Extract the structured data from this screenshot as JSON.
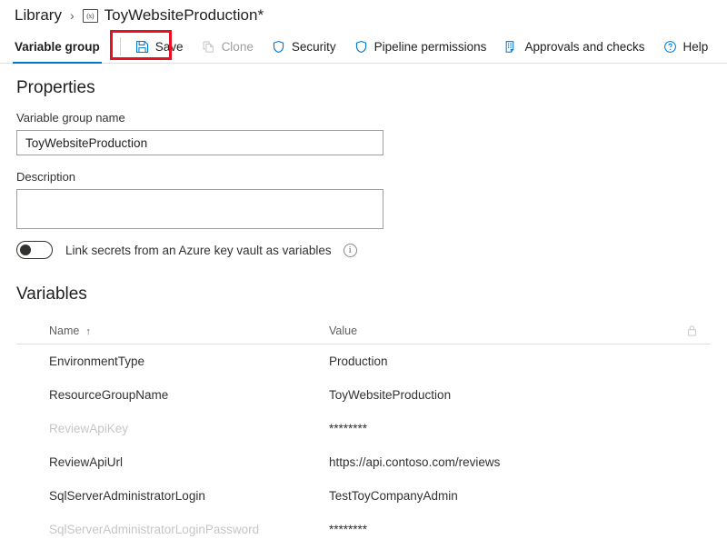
{
  "breadcrumb": {
    "root_label": "Library",
    "separator": "›",
    "icon_text": "(x)",
    "icon_name": "variable-group-icon",
    "current_label": "ToyWebsiteProduction*"
  },
  "toolbar": {
    "tab_label": "Variable group",
    "save_label": "Save",
    "clone_label": "Clone",
    "security_label": "Security",
    "pipeline_permissions_label": "Pipeline permissions",
    "approvals_label": "Approvals and checks",
    "help_label": "Help",
    "accent_color": "#0078d4",
    "highlight_color": "#e81123",
    "disabled_color": "#a19f9d"
  },
  "properties": {
    "section_title": "Properties",
    "name_label": "Variable group name",
    "name_value": "ToyWebsiteProduction",
    "name_placeholder": "",
    "description_label": "Description",
    "description_value": "",
    "description_placeholder": "",
    "keyvault_toggle_label": "Link secrets from an Azure key vault as variables",
    "keyvault_toggle_state": "off",
    "info_glyph": "i"
  },
  "variables": {
    "section_title": "Variables",
    "columns": {
      "name": "Name",
      "sort_indicator": "↑",
      "value": "Value",
      "lock": "lock-icon"
    },
    "rows": [
      {
        "name": "EnvironmentType",
        "value": "Production",
        "secret": false
      },
      {
        "name": "ResourceGroupName",
        "value": "ToyWebsiteProduction",
        "secret": false
      },
      {
        "name": "ReviewApiKey",
        "value": "********",
        "secret": true
      },
      {
        "name": "ReviewApiUrl",
        "value": "https://api.contoso.com/reviews",
        "secret": false
      },
      {
        "name": "SqlServerAdministratorLogin",
        "value": "TestToyCompanyAdmin",
        "secret": false
      },
      {
        "name": "SqlServerAdministratorLoginPassword",
        "value": "********",
        "secret": true
      }
    ]
  }
}
